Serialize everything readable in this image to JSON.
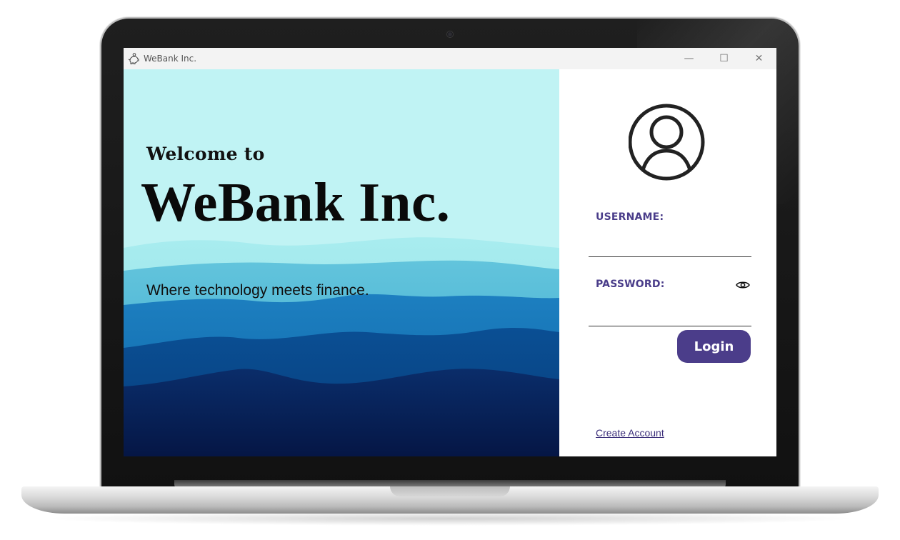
{
  "window": {
    "title": "WeBank Inc.",
    "controls": {
      "minimize": "—",
      "maximize": "☐",
      "close": "✕"
    }
  },
  "hero": {
    "welcome_small": "Welcome to",
    "welcome_big": "WeBank Inc.",
    "tagline": "Where technology meets finance.",
    "colors": {
      "sky": "#c0f3f4",
      "deep": "#061a4a",
      "mid": "#0a5a9a"
    }
  },
  "login": {
    "avatar_icon": "user-circle-icon",
    "username_label": "USERNAME:",
    "username_value": "",
    "password_label": "PASSWORD:",
    "password_value": "",
    "show_password_icon": "eye-icon",
    "login_button": "Login",
    "create_account_link": "Create Account",
    "accent_color": "#4b3d8a"
  }
}
